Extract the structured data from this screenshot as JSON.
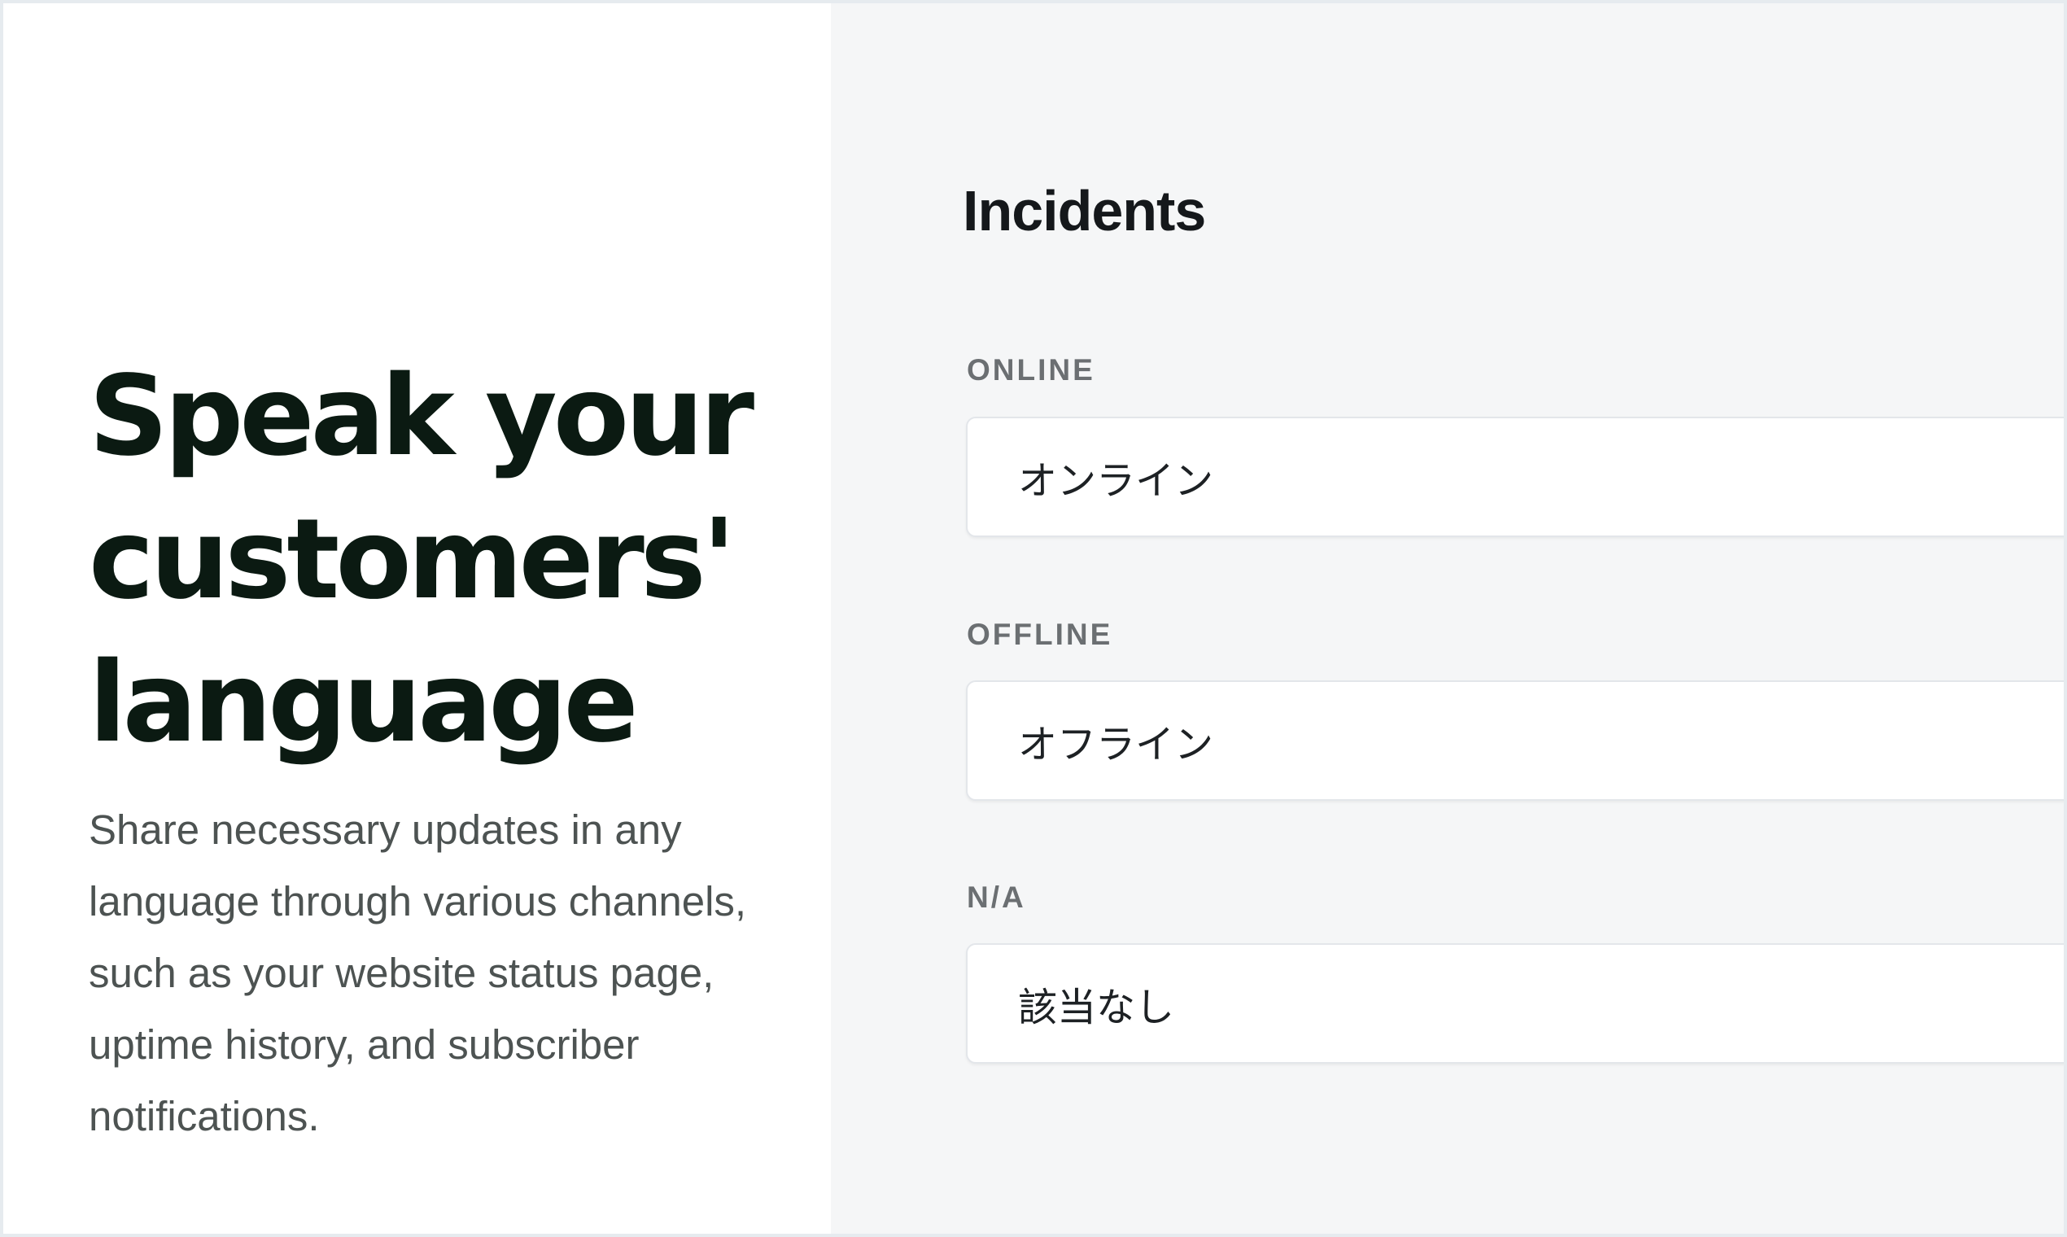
{
  "hero": {
    "headline_lines": [
      "Speak your",
      "customers'",
      "language"
    ],
    "description": "Share necessary updates in any language through various channels, such as your website status page, uptime history, and subscriber notifications."
  },
  "incidents": {
    "title": "Incidents",
    "fields": [
      {
        "label": "ONLINE",
        "value": "オンライン"
      },
      {
        "label": "OFFLINE",
        "value": "オフライン"
      },
      {
        "label": "N/A",
        "value": "該当なし"
      }
    ]
  },
  "colors": {
    "headline": "#0b1a12",
    "panel_background": "#f5f6f7",
    "label": "#6b6f72"
  }
}
